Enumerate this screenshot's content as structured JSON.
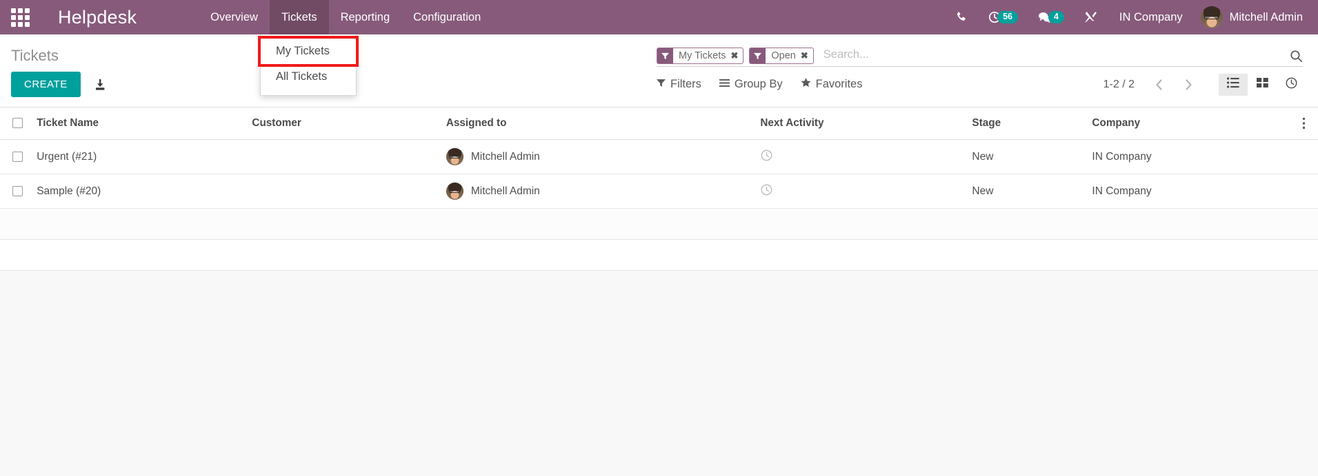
{
  "navbar": {
    "apps_icon": "apps-grid-icon",
    "brand": "Helpdesk",
    "menu": [
      {
        "label": "Overview",
        "active": false
      },
      {
        "label": "Tickets",
        "active": true
      },
      {
        "label": "Reporting",
        "active": false
      },
      {
        "label": "Configuration",
        "active": false
      }
    ],
    "sys_icons": [
      {
        "name": "phone-icon",
        "badge": null
      },
      {
        "name": "activity-clock-icon",
        "badge": "56"
      },
      {
        "name": "messages-icon",
        "badge": "4"
      },
      {
        "name": "tools-wrench-icon",
        "badge": null
      }
    ],
    "company": "IN Company",
    "user": "Mitchell Admin",
    "colors": {
      "bar": "#875A7B",
      "active_tab": "#714B64",
      "badge": "#00A09D"
    }
  },
  "dropdown": {
    "open_for": "Tickets",
    "items": [
      {
        "label": "My Tickets",
        "highlighted": true
      },
      {
        "label": "All Tickets",
        "highlighted": false
      }
    ],
    "highlight_color": "#F01A1A"
  },
  "control_panel": {
    "breadcrumb": "Tickets",
    "create_label": "CREATE",
    "import_icon": "import-download-icon",
    "search": {
      "placeholder": "Search...",
      "value": "",
      "facets": [
        {
          "icon": "filter-funnel-icon",
          "label": "My Tickets",
          "remove": "✖"
        },
        {
          "icon": "filter-funnel-icon",
          "label": "Open",
          "remove": "✖"
        }
      ],
      "submit_icon": "search-icon"
    },
    "menus": [
      {
        "icon": "filter-funnel-icon",
        "label": "Filters"
      },
      {
        "icon": "group-lines-icon",
        "label": "Group By"
      },
      {
        "icon": "star-icon",
        "label": "Favorites"
      }
    ],
    "pager": {
      "count": "1-2 / 2",
      "prev_icon": "chevron-left-icon",
      "next_icon": "chevron-right-icon"
    },
    "views": [
      {
        "name": "list-view-icon",
        "active": true
      },
      {
        "name": "kanban-view-icon",
        "active": false
      },
      {
        "name": "activity-view-icon",
        "active": false
      }
    ]
  },
  "table": {
    "columns": [
      "Ticket Name",
      "Customer",
      "Assigned to",
      "Next Activity",
      "Stage",
      "Company"
    ],
    "options_icon": "column-options-icon",
    "rows": [
      {
        "ticket_name": "Urgent (#21)",
        "customer": "",
        "assigned_to": "Mitchell Admin",
        "next_activity": "",
        "next_activity_icon": "clock-icon",
        "stage": "New",
        "company": "IN Company"
      },
      {
        "ticket_name": "Sample (#20)",
        "customer": "",
        "assigned_to": "Mitchell Admin",
        "next_activity": "",
        "next_activity_icon": "clock-icon",
        "stage": "New",
        "company": "IN Company"
      }
    ]
  }
}
